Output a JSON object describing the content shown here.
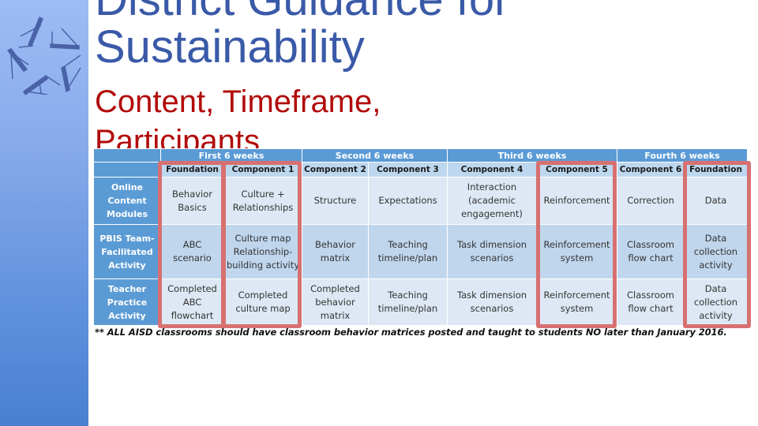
{
  "title": {
    "line1": "District Guidance for",
    "line2": "Sustainability"
  },
  "subtitle": {
    "line1": "Content, Timeframe,",
    "line2": "Participants"
  },
  "logo": {
    "icon": "star-of-letter-a-logo-icon"
  },
  "schedule": {
    "periods": [
      "First 6 weeks",
      "Second 6 weeks",
      "Third 6 weeks",
      "Fourth 6 weeks"
    ],
    "components": [
      "Foundation",
      "Component 1",
      "Component 2",
      "Component 3",
      "Component 4",
      "Component 5",
      "Component 6",
      "Foundation"
    ],
    "rows": [
      {
        "label": "Online Content Modules",
        "cells": [
          "Behavior Basics",
          "Culture + Relationships",
          "Structure",
          "Expectations",
          "Interaction (academic engagement)",
          "Reinforcement",
          "Correction",
          "Data"
        ]
      },
      {
        "label": "PBIS Team-Facilitated Activity",
        "cells": [
          "ABC scenario",
          "Culture map Relationship-building activity",
          "Behavior matrix",
          "Teaching timeline/plan",
          "Task dimension scenarios",
          "Reinforcement system",
          "Classroom flow chart",
          "Data collection activity"
        ]
      },
      {
        "label": "Teacher Practice Activity",
        "cells": [
          "Completed ABC flowchart",
          "Completed culture map",
          "Completed behavior matrix",
          "Teaching timeline/plan",
          "Task dimension scenarios",
          "Reinforcement system",
          "Classroom flow chart",
          "Data collection activity"
        ]
      }
    ],
    "highlighted_columns": [
      "Foundation",
      "Component 1",
      "Component 5",
      "Foundation"
    ],
    "colors": {
      "header": "#5b9bd5",
      "subheader": "#bdd7ee",
      "highlight": "#d77070"
    }
  },
  "footnote": "** ALL AISD classrooms should have classroom behavior matrices posted and taught to students NO later than January 2016."
}
